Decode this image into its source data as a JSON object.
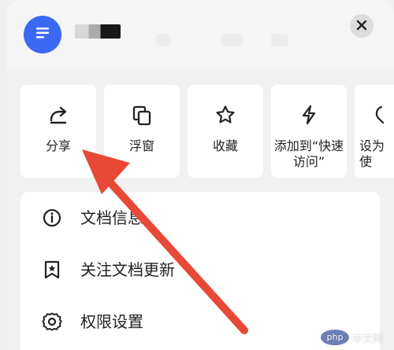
{
  "header": {
    "close_icon": "close-icon",
    "doc_icon": "document-lines-icon",
    "accent_color": "#3c69f3"
  },
  "actions": [
    {
      "label": "分享",
      "icon": "share-icon"
    },
    {
      "label": "浮窗",
      "icon": "floating-window-icon"
    },
    {
      "label": "收藏",
      "icon": "star-icon"
    },
    {
      "label": "添加到“快速\n访问”",
      "icon": "lightning-icon"
    },
    {
      "label": "设为\n使",
      "icon": "pin-icon"
    }
  ],
  "menu": [
    {
      "label": "文档信息",
      "icon": "info-icon"
    },
    {
      "label": "关注文档更新",
      "icon": "bookmark-star-icon"
    },
    {
      "label": "权限设置",
      "icon": "gear-icon"
    }
  ],
  "overlay": {
    "arrow_color": "#ee4a36"
  },
  "watermark": {
    "php": "php",
    "text": "中文网"
  }
}
